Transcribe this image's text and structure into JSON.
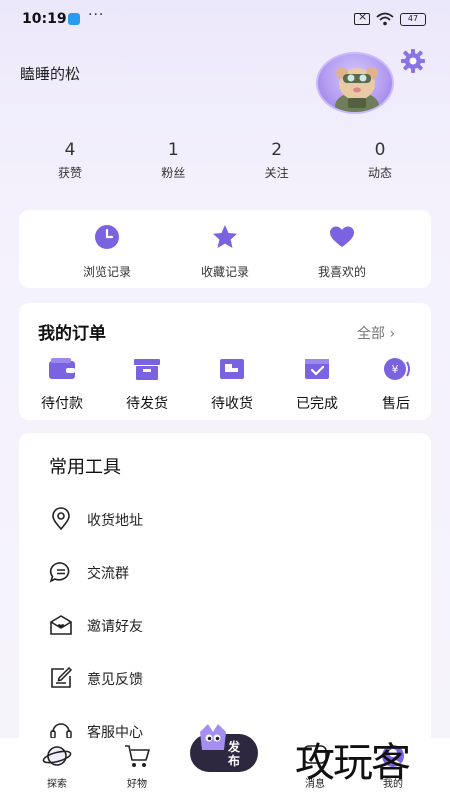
{
  "status_bar": {
    "time": "10:19",
    "dots": "···",
    "battery": "47"
  },
  "profile": {
    "username": "瞌睡的松"
  },
  "stats": [
    {
      "num": "4",
      "label": "获赞"
    },
    {
      "num": "1",
      "label": "粉丝"
    },
    {
      "num": "2",
      "label": "关注"
    },
    {
      "num": "0",
      "label": "动态"
    }
  ],
  "history": [
    {
      "label": "浏览记录",
      "icon": "clock-icon"
    },
    {
      "label": "收藏记录",
      "icon": "star-icon"
    },
    {
      "label": "我喜欢的",
      "icon": "heart-icon"
    }
  ],
  "orders": {
    "title": "我的订单",
    "all": "全部 ›",
    "items": [
      {
        "label": "待付款",
        "icon": "wallet-icon"
      },
      {
        "label": "待发货",
        "icon": "package-icon"
      },
      {
        "label": "待收货",
        "icon": "truck-icon"
      },
      {
        "label": "已完成",
        "icon": "check-box-icon"
      },
      {
        "label": "售后",
        "icon": "yen-icon"
      }
    ]
  },
  "tools": {
    "title": "常用工具",
    "items": [
      {
        "label": "收货地址",
        "icon": "location-icon"
      },
      {
        "label": "交流群",
        "icon": "chat-icon"
      },
      {
        "label": "邀请好友",
        "icon": "invite-icon"
      },
      {
        "label": "意见反馈",
        "icon": "feedback-icon"
      },
      {
        "label": "客服中心",
        "icon": "headset-icon"
      }
    ]
  },
  "tabbar": {
    "items": [
      {
        "label": "探索",
        "icon": "planet-icon"
      },
      {
        "label": "好物",
        "icon": "cart-icon"
      },
      {
        "label": "消息",
        "icon": "message-icon"
      },
      {
        "label": "我的",
        "icon": "profile-icon"
      }
    ],
    "publish": "发布"
  },
  "watermark": "攻玩客",
  "colors": {
    "accent": "#7b62e0",
    "background": "#f4f1fc",
    "card": "#ffffff"
  }
}
